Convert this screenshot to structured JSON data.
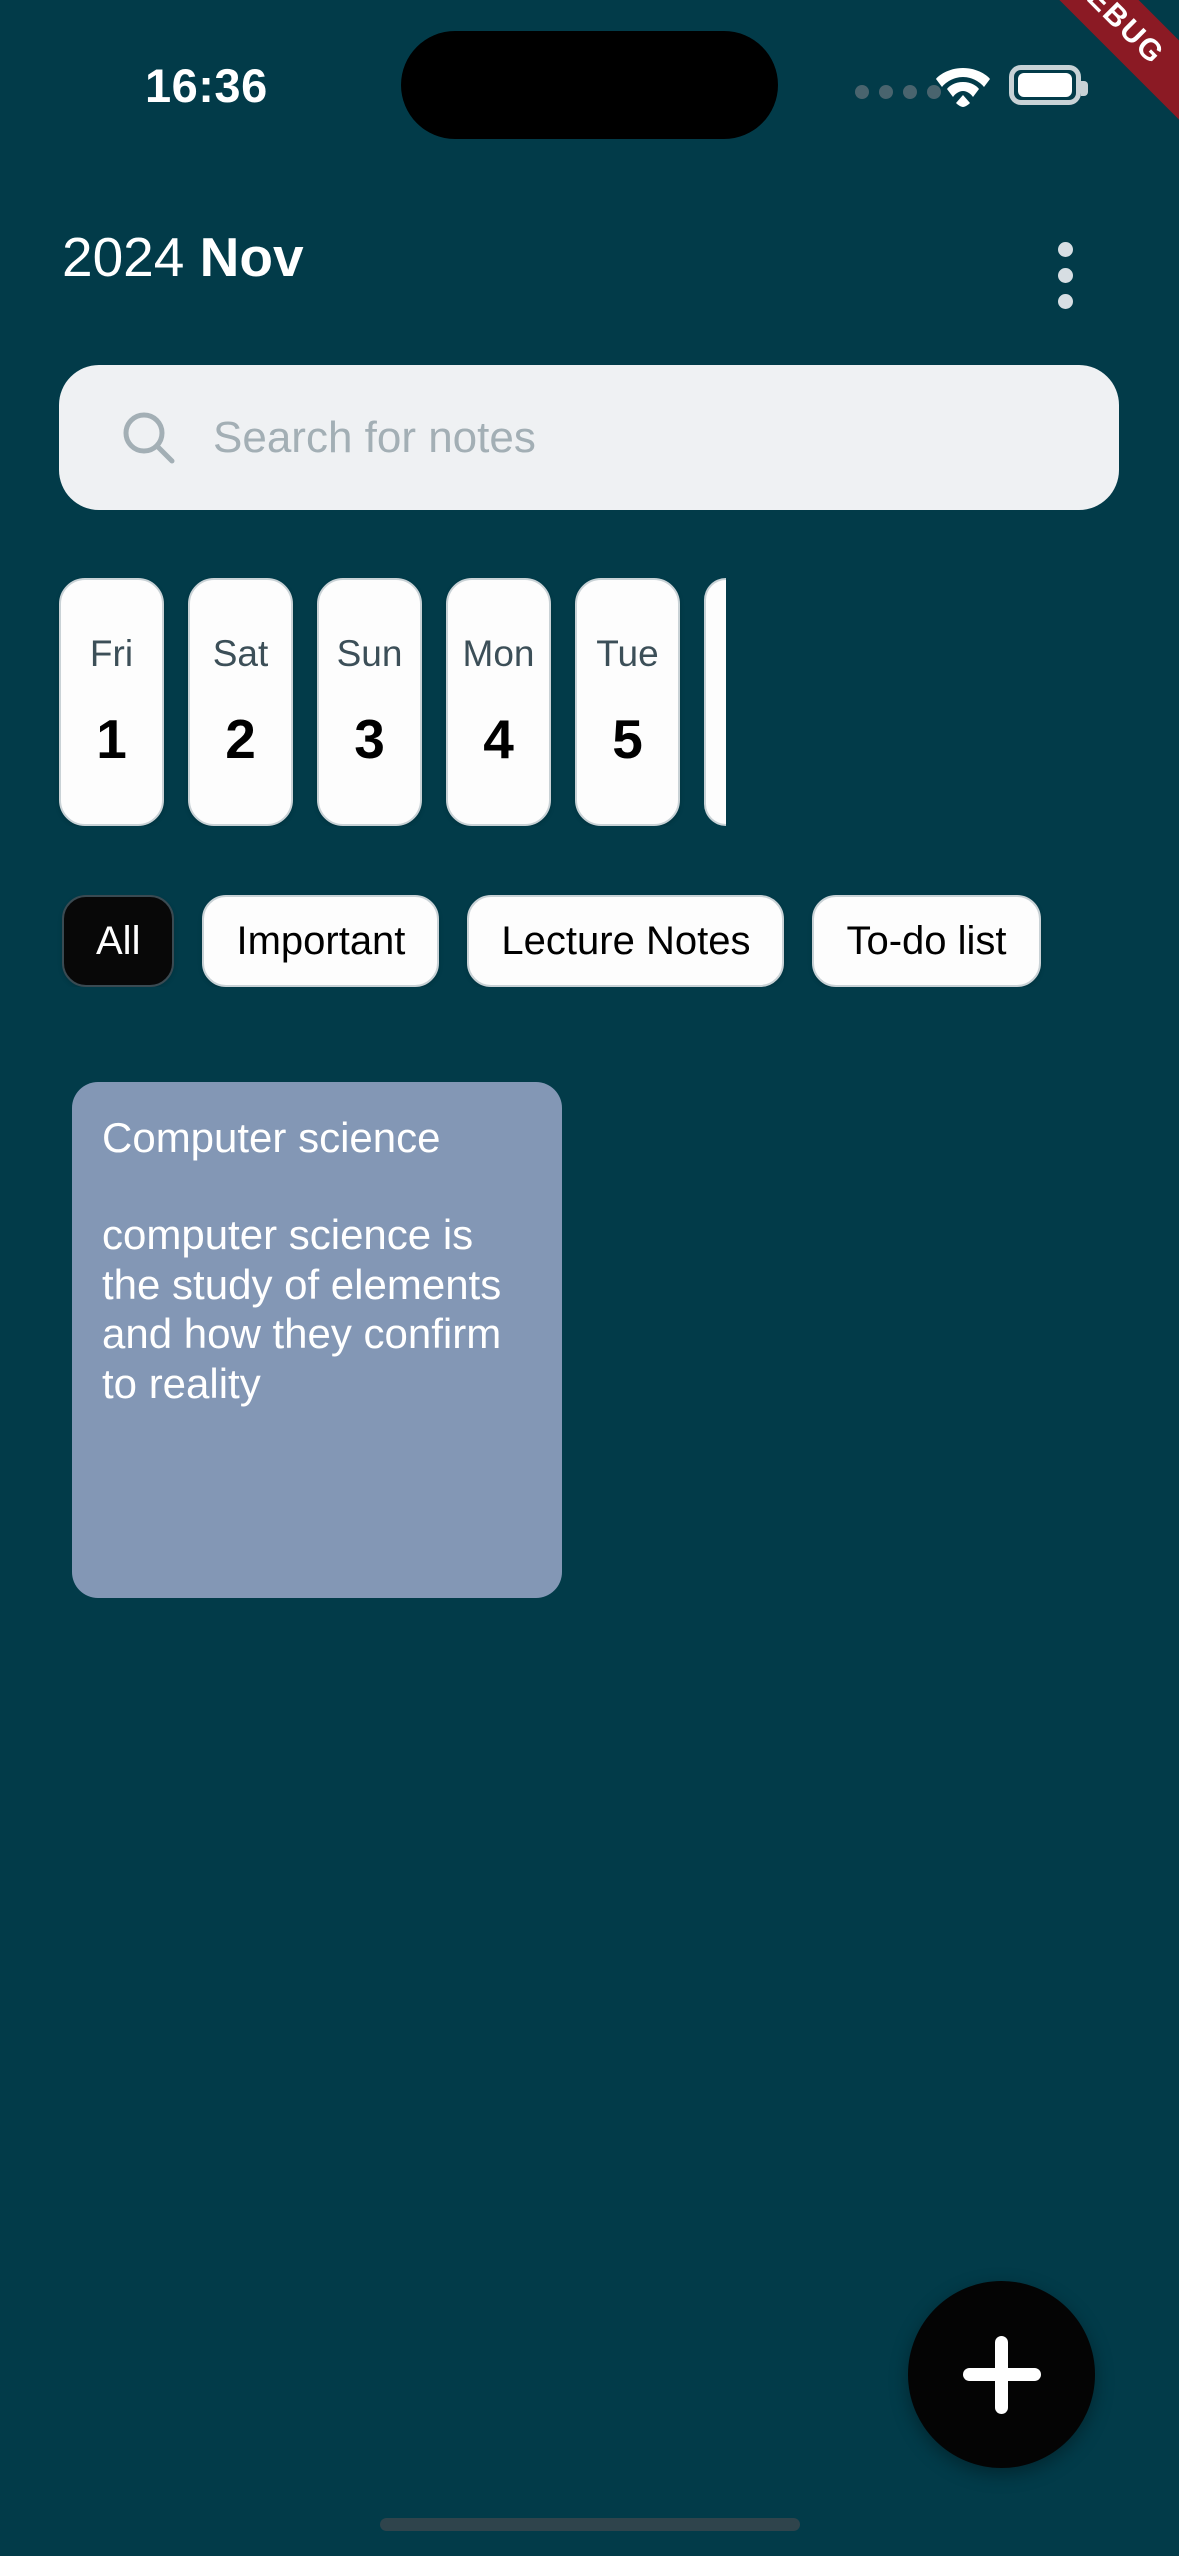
{
  "theme": {
    "background": "#023B49",
    "card_white": "#FDFDFD",
    "note_card": "#8397B5",
    "accent_black": "#080808",
    "search_field": "#EFF1F3",
    "debug_ribbon": "#8B1A24"
  },
  "status_bar": {
    "time": "16:36",
    "signal_icon": "signal-dots-icon",
    "wifi_icon": "wifi-icon",
    "battery_icon": "battery-icon",
    "debug_label": "DEBUG"
  },
  "header": {
    "year": "2024",
    "month": "Nov",
    "overflow_menu_icon": "more-vertical-icon"
  },
  "search": {
    "placeholder": "Search for notes",
    "value": "",
    "icon": "search-icon"
  },
  "date_strip": {
    "days": [
      {
        "dow": "Fri",
        "num": "1"
      },
      {
        "dow": "Sat",
        "num": "2"
      },
      {
        "dow": "Sun",
        "num": "3"
      },
      {
        "dow": "Mon",
        "num": "4"
      },
      {
        "dow": "Tue",
        "num": "5"
      }
    ]
  },
  "filters": {
    "chips": [
      {
        "label": "All",
        "selected": true
      },
      {
        "label": "Important",
        "selected": false
      },
      {
        "label": "Lecture Notes",
        "selected": false
      },
      {
        "label": "To-do list",
        "selected": false
      }
    ]
  },
  "notes": [
    {
      "title": "Computer science",
      "body": "computer science is the study of elements and how they confirm to reality"
    }
  ],
  "fab": {
    "icon": "plus-icon",
    "label": "Add note"
  },
  "home_indicator": {
    "label": "home-indicator"
  }
}
